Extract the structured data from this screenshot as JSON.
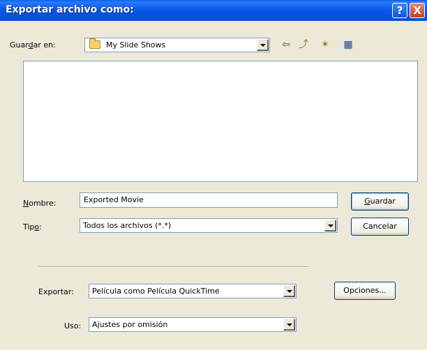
{
  "window": {
    "title": "Exportar archivo como:",
    "help_label": "?",
    "close_label": "X"
  },
  "location": {
    "label_pre": "Guar",
    "label_key": "d",
    "label_post": "ar en:",
    "value": "My Slide Shows"
  },
  "toolbar": {
    "back_glyph": "⇦",
    "up_glyph": "⤴",
    "newfolder_glyph": "✶",
    "view_glyph": "▦"
  },
  "name": {
    "label_key": "N",
    "label_post": "ombre:",
    "value": "Exported Movie"
  },
  "type": {
    "label_pre": "Tip",
    "label_key": "o",
    "label_post": ":",
    "value": "Todos los archivos (*.*)"
  },
  "buttons": {
    "save_key": "G",
    "save_post": "uardar",
    "cancel": "Cancelar",
    "options": "Opciones..."
  },
  "export": {
    "label": "Exportar:",
    "value": "Película como Película QuickTime"
  },
  "use": {
    "label": "Uso:",
    "value": "Ajustes por omisión"
  }
}
